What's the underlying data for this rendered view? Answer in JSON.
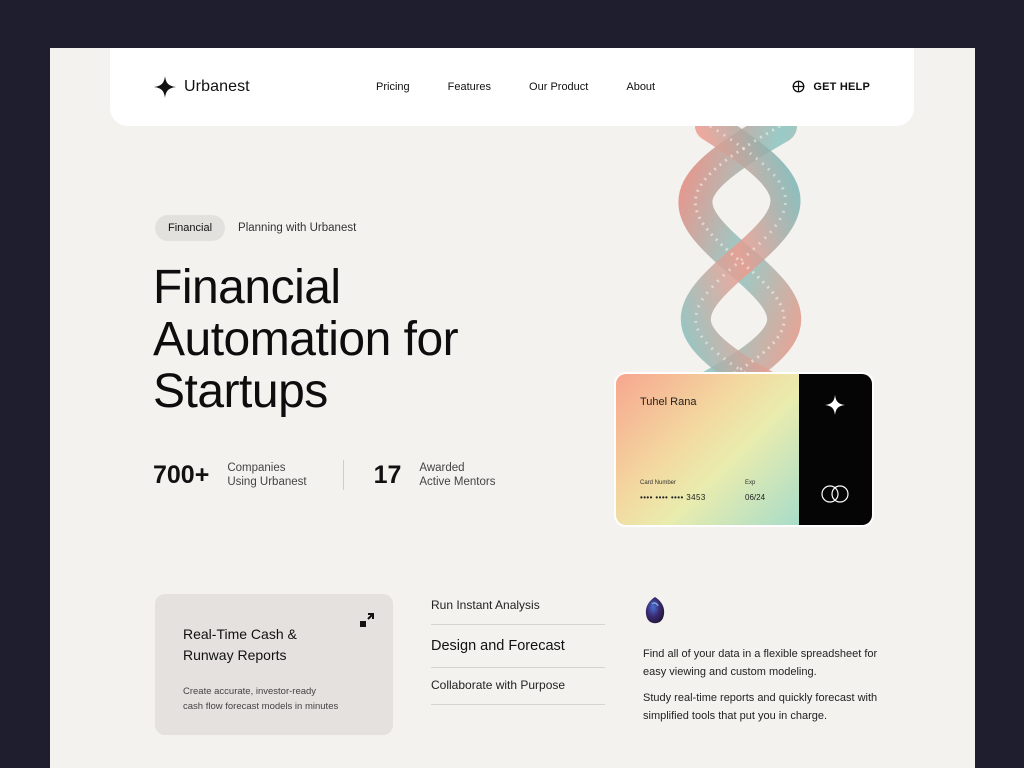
{
  "nav": {
    "brand": "Urbanest",
    "links": [
      "Pricing",
      "Features",
      "Our Product",
      "About"
    ],
    "help_label": "GET HELP"
  },
  "hero": {
    "tag_pill": "Financial",
    "tag_text": "Planning with Urbanest",
    "title_lines": [
      "Financial",
      "Automation for",
      "Startups"
    ],
    "stats": [
      {
        "number": "700+",
        "label_lines": [
          "Companies",
          "Using Urbanest"
        ]
      },
      {
        "number": "17",
        "label_lines": [
          "Awarded",
          "Active Mentors"
        ]
      }
    ]
  },
  "card": {
    "holder": "Tuhel Rana",
    "number_label": "Card Number",
    "number": "•••• •••• ••••  3453",
    "exp_label": "Exp",
    "exp": "06/24"
  },
  "feature_box": {
    "title_lines": [
      "Real-Time Cash &",
      "Runway Reports"
    ],
    "desc_lines": [
      "Create accurate, investor-ready",
      "cash flow forecast models in minutes"
    ]
  },
  "menu": {
    "items": [
      "Run Instant Analysis",
      "Design and Forecast",
      "Collaborate with Purpose"
    ]
  },
  "info": {
    "paragraphs": [
      "Find all of your data in a flexible spreadsheet for easy viewing and custom modeling.",
      "Study real-time reports and quickly forecast with simplified tools that put you in charge."
    ]
  },
  "colors": {
    "frame": "#1f1e2e",
    "page_bg": "#f3f2ef",
    "card_back": "#050505",
    "feature_box": "#e4e1de"
  }
}
